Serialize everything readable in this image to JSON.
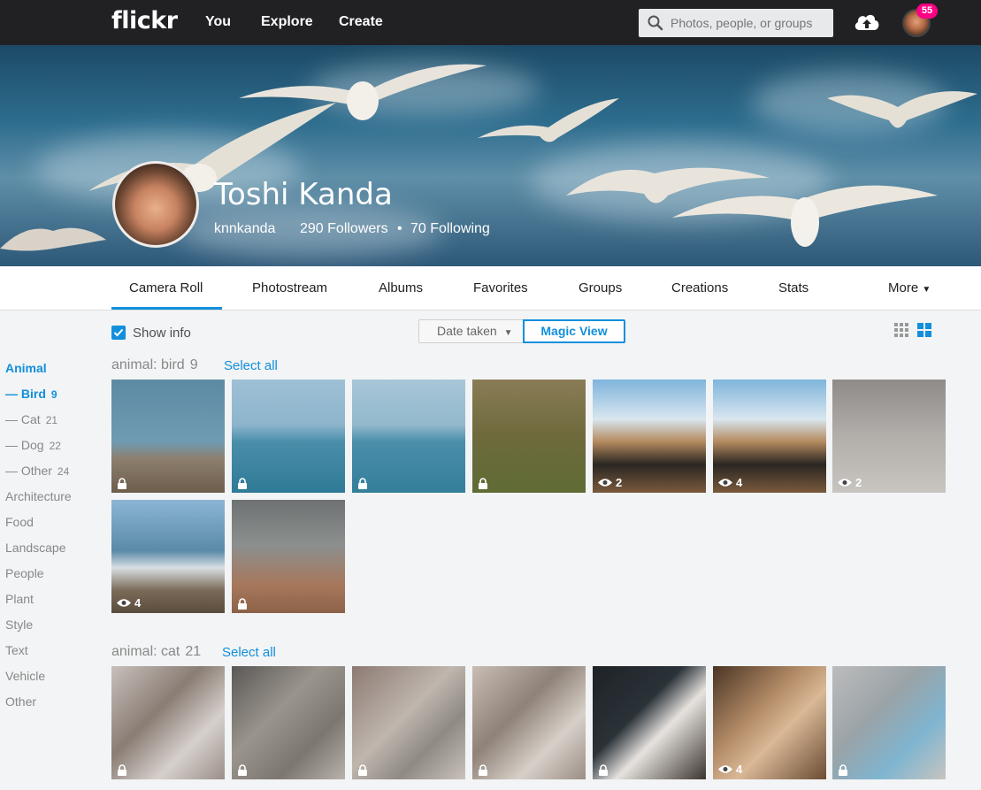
{
  "nav": {
    "logo": "flickr",
    "links": [
      "You",
      "Explore",
      "Create"
    ],
    "search_placeholder": "Photos, people, or groups",
    "notification_count": "55"
  },
  "profile": {
    "name": "Toshi Kanda",
    "username": "knnkanda",
    "followers": "290 Followers",
    "separator": "•",
    "following": "70 Following"
  },
  "tabs": [
    "Camera Roll",
    "Photostream",
    "Albums",
    "Favorites",
    "Groups",
    "Creations",
    "Stats",
    "More"
  ],
  "controls": {
    "show_info": "Show info",
    "date_taken": "Date taken",
    "magic_view": "Magic View"
  },
  "sidebar": {
    "heading": "Animal",
    "sub": [
      {
        "label": "Bird",
        "count": "9"
      },
      {
        "label": "Cat",
        "count": "21"
      },
      {
        "label": "Dog",
        "count": "22"
      },
      {
        "label": "Other",
        "count": "24"
      }
    ],
    "categories": [
      "Architecture",
      "Food",
      "Landscape",
      "People",
      "Plant",
      "Style",
      "Text",
      "Vehicle",
      "Other"
    ]
  },
  "sections": [
    {
      "title": "animal: bird",
      "count": "9",
      "select_all": "Select all",
      "photos": [
        {
          "subject": "gull-on-pier",
          "icon": "lock",
          "views": ""
        },
        {
          "subject": "gull-bay",
          "icon": "lock",
          "views": ""
        },
        {
          "subject": "gull-bay-2",
          "icon": "lock",
          "views": ""
        },
        {
          "subject": "duck-grass",
          "icon": "lock",
          "views": ""
        },
        {
          "subject": "ostriches",
          "icon": "eye",
          "views": "2"
        },
        {
          "subject": "ostriches-2",
          "icon": "eye",
          "views": "4"
        },
        {
          "subject": "bird-sand",
          "icon": "eye",
          "views": "2"
        },
        {
          "subject": "beach-surfers",
          "icon": "eye",
          "views": "4"
        },
        {
          "subject": "luggage-cart",
          "icon": "lock",
          "views": ""
        }
      ]
    },
    {
      "title": "animal: cat",
      "count": "21",
      "select_all": "Select all",
      "photos": [
        {
          "subject": "cats-sleeping",
          "icon": "lock",
          "views": ""
        },
        {
          "subject": "tabby-lying",
          "icon": "lock",
          "views": ""
        },
        {
          "subject": "tabby-couch",
          "icon": "lock",
          "views": ""
        },
        {
          "subject": "cats-cuddle",
          "icon": "lock",
          "views": ""
        },
        {
          "subject": "cat-yawn",
          "icon": "lock",
          "views": ""
        },
        {
          "subject": "cat-face",
          "icon": "eye",
          "views": "4"
        },
        {
          "subject": "cat-teddy",
          "icon": "lock",
          "views": ""
        }
      ]
    }
  ],
  "colors": {
    "accent": "#128fdc",
    "nav_bg": "#212124",
    "badge": "#ff0084",
    "page_bg": "#f2f4f5"
  }
}
